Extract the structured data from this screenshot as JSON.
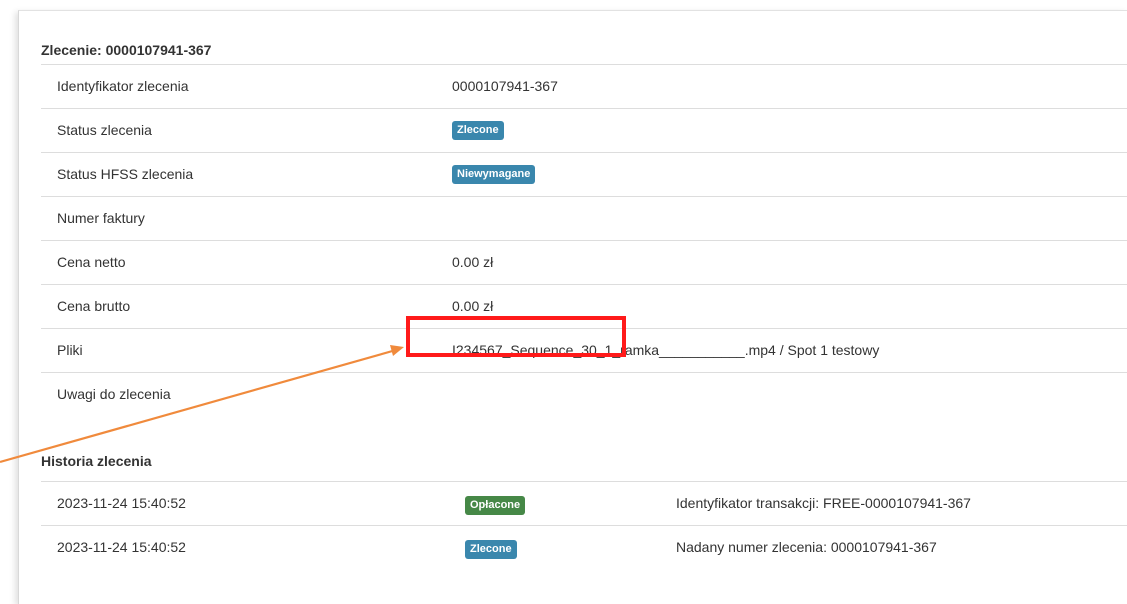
{
  "order": {
    "title": "Zlecenie: 0000107941-367",
    "rows": [
      {
        "label": "Identyfikator zlecenia",
        "value": "0000107941-367"
      },
      {
        "label": "Status zlecenia",
        "badge": "Zlecone"
      },
      {
        "label": "Status HFSS zlecenia",
        "badge": "Niewymagane"
      },
      {
        "label": "Numer faktury",
        "value": ""
      },
      {
        "label": "Cena netto",
        "value": "0.00 zł"
      },
      {
        "label": "Cena brutto",
        "value": "0.00 zł"
      },
      {
        "label": "Pliki",
        "value": "I234567_Sequence_30_1_ramka___________.mp4 / Spot 1 testowy"
      },
      {
        "label": "Uwagi do zlecenia",
        "value": ""
      }
    ]
  },
  "history": {
    "title": "Historia zlecenia",
    "rows": [
      {
        "date": "2023-11-24 15:40:52",
        "badge": "Opłacone",
        "badge_color": "#468847",
        "note": "Identyfikator transakcji: FREE-0000107941-367"
      },
      {
        "date": "2023-11-24 15:40:52",
        "badge": "Zlecone",
        "badge_color": "#3a87ad",
        "note": "Nadany numer zlecenia: 0000107941-367"
      }
    ]
  },
  "colors": {
    "badge_blue": "#3a87ad",
    "badge_green": "#468847",
    "highlight": "#ff1a1a",
    "arrow": "#f08a3c"
  }
}
